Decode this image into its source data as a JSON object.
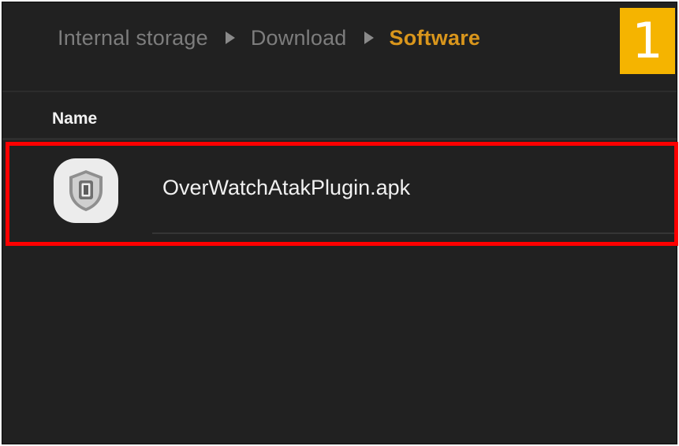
{
  "breadcrumb": {
    "items": [
      "Internal storage",
      "Download",
      "Software"
    ]
  },
  "step_badge": "1",
  "list": {
    "column_header": "Name",
    "files": [
      {
        "name": "OverWatchAtakPlugin.apk",
        "icon": "shield-app-icon"
      }
    ]
  },
  "colors": {
    "background": "#212121",
    "breadcrumb_text": "#7d7d7d",
    "breadcrumb_active": "#d9961c",
    "badge": "#f5b400",
    "highlight": "#ff0000"
  }
}
